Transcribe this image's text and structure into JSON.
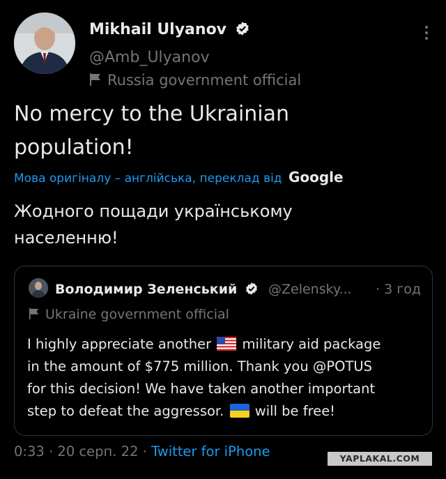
{
  "author": {
    "name": "Mikhail Ulyanov",
    "handle": "@Amb_Ulyanov",
    "label": "Russia government official",
    "verified": true
  },
  "tweet": {
    "text_line1": "No mercy to the Ukrainian",
    "text_line2": "population!",
    "translation_note": "Мова оригіналу – англійська, переклад від",
    "translation_provider": "Google",
    "translated_line1": "Жодного пощади українському",
    "translated_line2": "населенню!"
  },
  "quoted_tweet": {
    "name": "Володимир Зеленський",
    "handle": "@Zelensky...",
    "time": "· 3 год",
    "label": "Ukraine government official",
    "line1_before": "I highly appreciate another",
    "line1_after": "military aid package",
    "line2": "in the amount of $775 million. Thank you @POTUS",
    "line3": "for this decision! We have taken another important",
    "line4_before": "step to defeat the aggressor.",
    "line4_after": "will be free!",
    "flag_emojis": [
      "us-flag-icon",
      "ukraine-flag-icon"
    ]
  },
  "meta": {
    "time": "0:33",
    "date": "20 серп. 22",
    "source": "Twitter for iPhone"
  },
  "watermark": "YAPLAKAL.COM",
  "colors": {
    "background": "#000000",
    "text": "#e7e9ea",
    "secondary": "#71767b",
    "link": "#1d9bf0",
    "border": "#2f3336"
  }
}
